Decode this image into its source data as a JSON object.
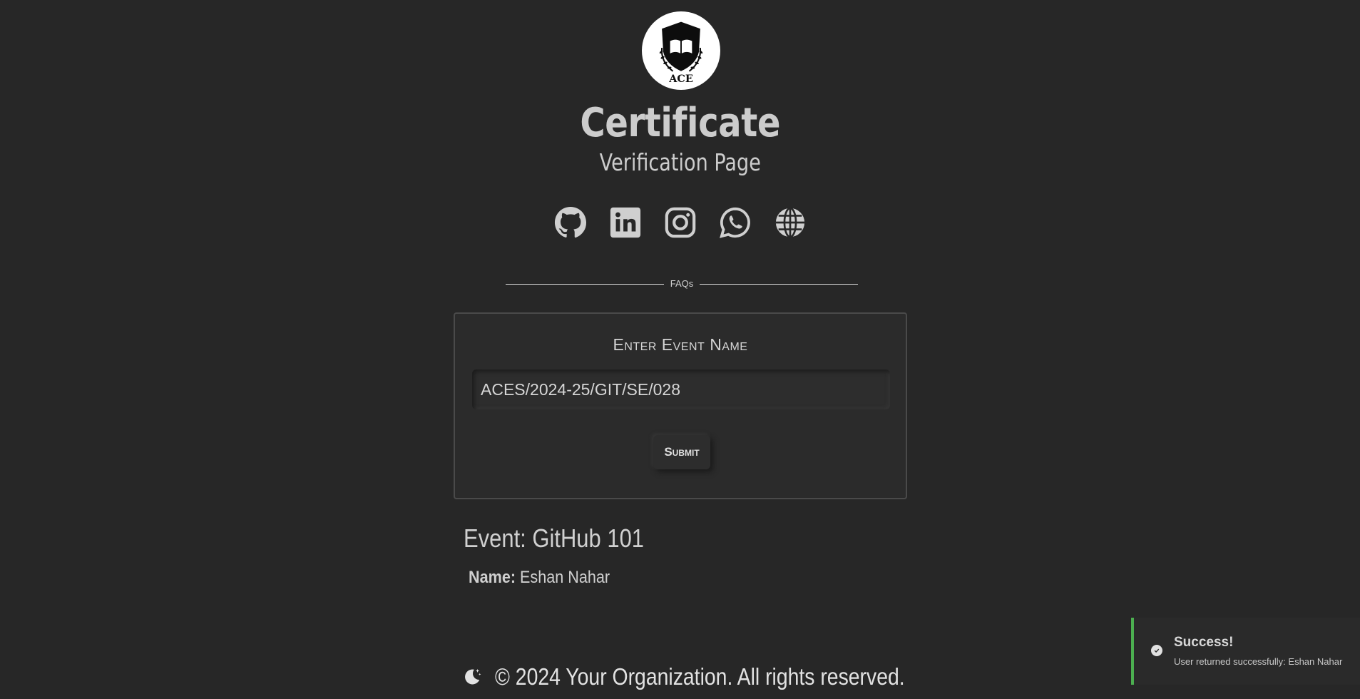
{
  "logo": {
    "text": "ACE",
    "icon": "shield-book-laurel-icon"
  },
  "header": {
    "title": "Certificate",
    "subtitle": "Verification Page"
  },
  "socials": [
    {
      "name": "github",
      "icon": "github-icon"
    },
    {
      "name": "linkedin",
      "icon": "linkedin-icon"
    },
    {
      "name": "instagram",
      "icon": "instagram-icon"
    },
    {
      "name": "whatsapp",
      "icon": "whatsapp-icon"
    },
    {
      "name": "website",
      "icon": "globe-icon"
    }
  ],
  "divider": {
    "label": "FAQs"
  },
  "form": {
    "label": "Enter Event Name",
    "input_value": "ACES/2024-25/GIT/SE/028",
    "submit_label": "Submit"
  },
  "result": {
    "event_prefix": "Event:",
    "event_name": "GitHub 101",
    "name_label": "Name:",
    "name_value": "Eshan Nahar"
  },
  "footer": {
    "copyright": "© 2024 Your Organization. All rights reserved.",
    "theme_icon": "moon-stars-icon"
  },
  "toast": {
    "title": "Success!",
    "message": "User returned successfully: Eshan Nahar",
    "accent_color": "#4caf50",
    "icon": "check-circle-icon"
  },
  "colors": {
    "background": "#272727",
    "card_border": "#4a4a4a",
    "text": "#cfcfcf"
  }
}
